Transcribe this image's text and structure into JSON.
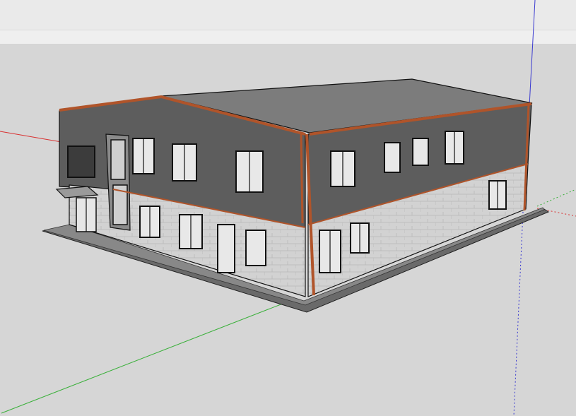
{
  "viewport": {
    "background_sky": "#efefef",
    "background_ground": "#d6d6d6"
  },
  "axes": {
    "red_color": "#d83030",
    "green_color": "#3ab03a",
    "blue_color": "#3a3ad0"
  },
  "model": {
    "description_icon": "3d-building-model",
    "wall_cladding_color": "#5d5d5d",
    "roof_color": "#7a7a7a",
    "trim_color": "#b0542a",
    "brick_color": "#d0d0d0",
    "slab_color": "#6a6a6a"
  }
}
